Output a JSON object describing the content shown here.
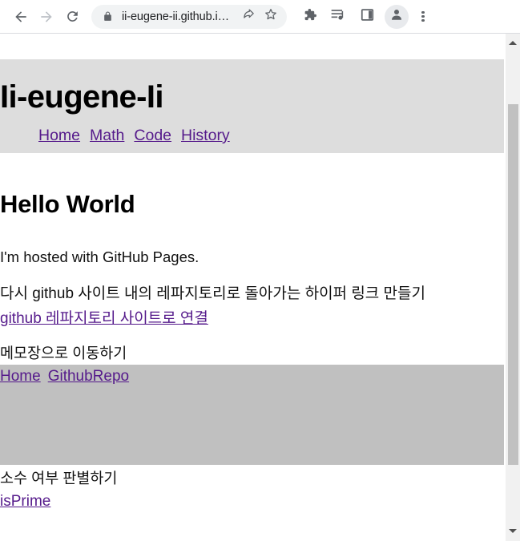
{
  "browser": {
    "back_icon": "back-arrow-icon",
    "forward_icon": "forward-arrow-icon",
    "reload_icon": "reload-icon",
    "lock_icon": "lock-icon",
    "url": "ii-eugene-ii.github.i…",
    "share_icon": "share-icon",
    "bookmark_icon": "star-icon",
    "extensions_icon": "puzzle-piece-icon",
    "media_icon": "media-playlist-icon",
    "side_panel_icon": "side-panel-icon",
    "profile_icon": "profile-avatar-icon",
    "menu_icon": "three-dot-menu-icon"
  },
  "site": {
    "title": "Ii-eugene-Ii",
    "nav": [
      {
        "label": "Home"
      },
      {
        "label": "Math"
      },
      {
        "label": "Code"
      },
      {
        "label": "History"
      }
    ]
  },
  "main": {
    "heading": "Hello World",
    "hosted_text": "I'm hosted with GitHub Pages.",
    "kor_line_1": "다시 github 사이트 내의 레파지토리로 돌아가는 하이퍼 링크 만들기",
    "repo_link": "github 레파지토리 사이트로 연결",
    "kor_line_2": "메모장으로 이동하기",
    "box_links": [
      {
        "label": "Home"
      },
      {
        "label": "GithubRepo"
      }
    ],
    "kor_line_3": "소수 여부 판별하기",
    "isprime_link": "isPrime"
  },
  "colors": {
    "link": "#551a8b",
    "header_band": "#dddddd",
    "gray_box": "#c0c0c0",
    "toolbar_bg": "#ffffff",
    "omnibox_bg": "#f1f3f4"
  },
  "scrollbar": {
    "up_arrow": "scroll-up-arrow-icon",
    "down_arrow": "scroll-down-arrow-icon"
  }
}
